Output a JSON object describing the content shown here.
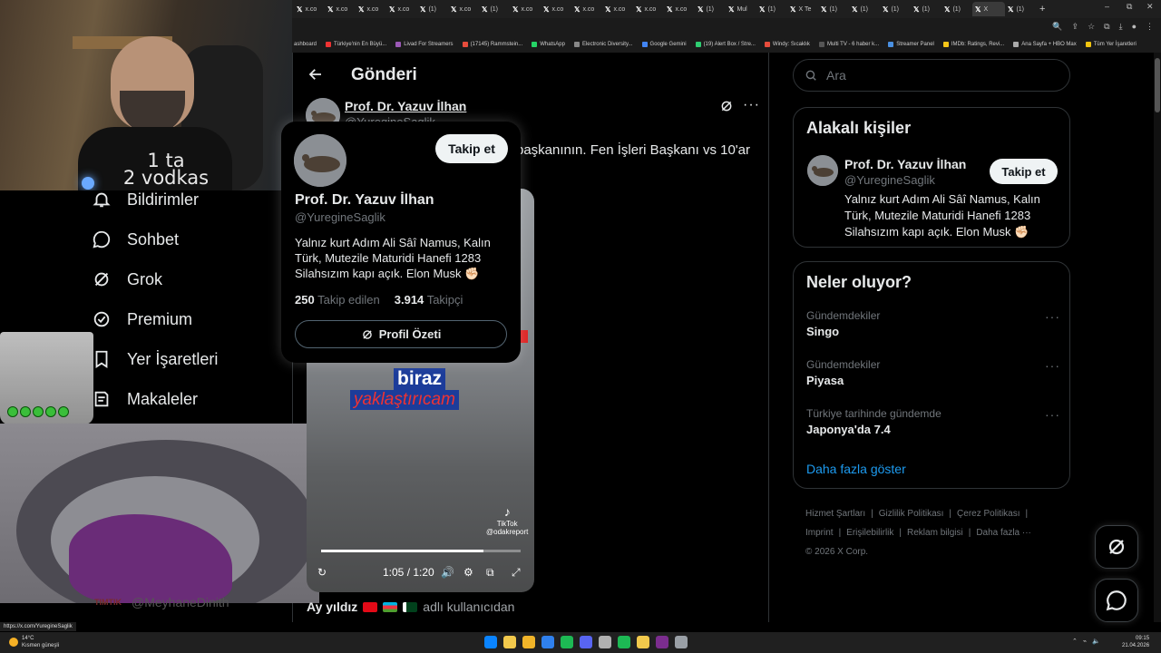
{
  "browser": {
    "tabs": [
      "x.co",
      "x.co",
      "x.co",
      "x.co",
      "(1)",
      "x.co",
      "(1)",
      "x.co",
      "x.co",
      "x.co",
      "x.co",
      "x.co",
      "x.co",
      "(1)",
      "Mul",
      "(1)",
      "X Te",
      "(1)",
      "(1)",
      "(1)",
      "(1)",
      "(1)",
      "X",
      "(1)"
    ],
    "bookmarks": [
      "ashboard",
      "Türkiye'nin En Büyü...",
      "Livad For Streamers",
      "(17145) Rammstein...",
      "WhatsApp",
      "Electronic Diversity...",
      "Google Gemini",
      "(19) Alert Box / Stre...",
      "Windy: Sıcaklık",
      "Multi TV - 6 haber k...",
      "Streamer Panel",
      "IMDb: Ratings, Revi...",
      "Ana Sayfa + HBO Max",
      "Tüm Yer İşaretleri"
    ],
    "status_url": "https://x.com/YuregineSaglik",
    "tab_new": "+",
    "win_controls": [
      "–",
      "⧉",
      "✕"
    ]
  },
  "overlays": {
    "shirt_text": "1 ta\n2 vodkas",
    "below_tag": "TIMTIK",
    "below_handle": "@MeyhaneDinith"
  },
  "nav": {
    "items": [
      {
        "label": "Bildirimler",
        "icon": "bell-icon"
      },
      {
        "label": "Sohbet",
        "icon": "chat-icon"
      },
      {
        "label": "Grok",
        "icon": "grok-icon"
      },
      {
        "label": "Premium",
        "icon": "premium-icon"
      },
      {
        "label": "Yer İşaretleri",
        "icon": "bookmark-icon"
      },
      {
        "label": "Makaleler",
        "icon": "article-icon"
      }
    ]
  },
  "main": {
    "page_title": "Gönderi",
    "author": {
      "name": "Prof. Dr. Yazuv İlhan",
      "handle": "@YuregineSaglik"
    },
    "post_text": "başkanının. Fen İşleri Başkanı vs 10'ar",
    "video": {
      "caption_top": "biraz",
      "caption_bottom": "yaklaştırıcam",
      "watermark_brand": "TikTok",
      "watermark_handle": "@odakreport",
      "time": "1:05 / 1:20",
      "progress": 0.8125
    },
    "bottom_line": {
      "bold": "Ay yıldız",
      "rest": "adlı kullanıcıdan"
    }
  },
  "hovercard": {
    "name": "Prof. Dr. Yazuv İlhan",
    "handle": "@YuregineSaglik",
    "follow_label": "Takip et",
    "bio": "Yalnız kurt Adım Ali Sâî Namus, Kalın Türk, Mutezile Maturidi Hanefi 1283 Silahsızım kapı açık. Elon Musk ✊🏻",
    "following_count": "250",
    "following_label": "Takip edilen",
    "followers_count": "3.914",
    "followers_label": "Takipçi",
    "summary_label": "Profil Özeti"
  },
  "right": {
    "search_placeholder": "Ara",
    "related": {
      "title": "Alakalı kişiler",
      "name": "Prof. Dr. Yazuv İlhan",
      "handle": "@YuregineSaglik",
      "follow_label": "Takip et",
      "bio": "Yalnız kurt Adım Ali Sâî Namus, Kalın Türk, Mutezile Maturidi Hanefi 1283 Silahsızım kapı açık. Elon Musk ✊🏻"
    },
    "trends": {
      "title": "Neler oluyor?",
      "items": [
        {
          "context": "Gündemdekiler",
          "name": "Singo"
        },
        {
          "context": "Gündemdekiler",
          "name": "Piyasa"
        },
        {
          "context": "Türkiye tarihinde gündemde",
          "name": "Japonya'da 7.4"
        }
      ],
      "show_more": "Daha fazla göster"
    },
    "footer": [
      "Hizmet Şartları",
      "|",
      "Gizlilik Politikası",
      "|",
      "Çerez Politikası",
      "|",
      "Imprint",
      "|",
      "Erişilebilirlik",
      "|",
      "Reklam bilgisi",
      "|",
      "Daha fazla ···",
      "© 2026 X Corp."
    ]
  },
  "taskbar": {
    "weather_temp": "14°C",
    "weather_desc": "Kısmen güneşli",
    "time": "09:15",
    "date": "21.04.2026",
    "icon_colors": [
      "#0a84ff",
      "#f2c94c",
      "#f0b429",
      "#2f80ed",
      "#1db954",
      "#5865f2",
      "#b0b0b0",
      "#1db954",
      "#f2c94c",
      "#7b2d8e",
      "#9aa0a6"
    ]
  },
  "colors": {
    "accent": "#1d9bf0",
    "background": "#000000",
    "border": "#2f3336",
    "muted": "#71767b"
  }
}
